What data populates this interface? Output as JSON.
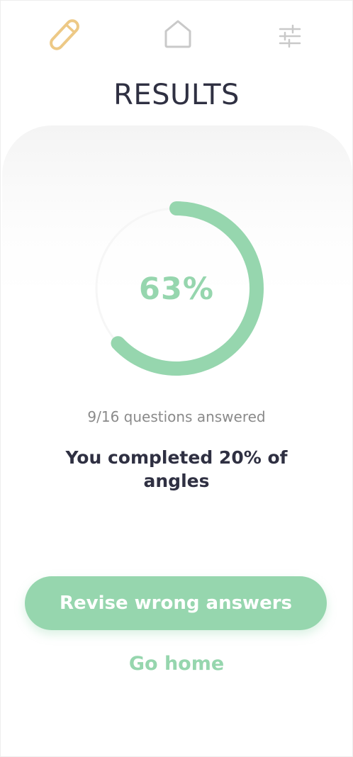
{
  "nav": {
    "icons": [
      "pencil-icon",
      "home-icon",
      "sliders-icon"
    ]
  },
  "title": "RESULTS",
  "progress": {
    "percent": 63,
    "label": "63%"
  },
  "summary": {
    "answered": "9/16 questions answered",
    "completed": "You completed 20% of angles"
  },
  "actions": {
    "revise_label": "Revise wrong answers",
    "home_label": "Go home"
  },
  "colors": {
    "accent_green": "#96d6ae",
    "pencil_yellow": "#edc986",
    "title_dark": "#2f3042",
    "icon_gray": "#c9c9c9"
  }
}
